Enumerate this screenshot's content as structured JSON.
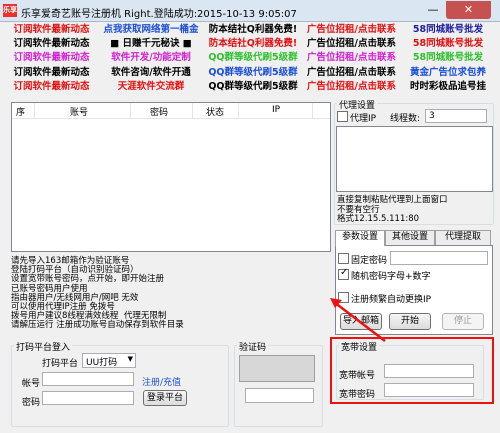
{
  "window": {
    "title": "乐享爱奇艺账号注册机    Right.登陆成功:2015-10-13 9:05:07",
    "icon_text": "乐享"
  },
  "ads": [
    [
      {
        "text": "订阅软件最新动态",
        "color": "#e11010"
      },
      {
        "text": "点我获取网络第一桶金",
        "color": "#1a4fd6"
      },
      {
        "text": "防本结社Q利器免费!",
        "color": "#000000"
      },
      {
        "text": "广告位招租/点击联系",
        "color": "#e11010"
      },
      {
        "text": "58同城账号批发",
        "color": "#2020a0"
      }
    ],
    [
      {
        "text": "订阅软件最新动态",
        "color": "#000000"
      },
      {
        "text": "■ 日赚千元秘诀 ■",
        "color": "#000000"
      },
      {
        "text": "防本结社Q利器免费!",
        "color": "#e11010"
      },
      {
        "text": "广告位招租/点击联系",
        "color": "#000000"
      },
      {
        "text": "58同城账号批发",
        "color": "#e11010"
      }
    ],
    [
      {
        "text": "订阅软件最新动态",
        "color": "#d020d0"
      },
      {
        "text": "软件开发/功能定制",
        "color": "#d020d0"
      },
      {
        "text": "QQ群等级代刷5级群",
        "color": "#30c030"
      },
      {
        "text": "广告位招租/点击联系",
        "color": "#d020d0"
      },
      {
        "text": "58同城账号批发",
        "color": "#30c030"
      }
    ],
    [
      {
        "text": "订阅软件最新动态",
        "color": "#000000"
      },
      {
        "text": "软件咨询/软件开通",
        "color": "#000000"
      },
      {
        "text": "QQ群等级代刷5级群",
        "color": "#1a4fd6"
      },
      {
        "text": "广告位招租/点击联系",
        "color": "#000000"
      },
      {
        "text": "黄金广告位求包养",
        "color": "#1a4fd6"
      }
    ],
    [
      {
        "text": "订阅软件最新动态",
        "color": "#e11010"
      },
      {
        "text": "天涯软件交流群",
        "color": "#e11010"
      },
      {
        "text": "QQ群等级代刷5级群",
        "color": "#000000"
      },
      {
        "text": "广告位招租/点击联系",
        "color": "#e11010"
      },
      {
        "text": "时时彩极品追号挂",
        "color": "#000000"
      }
    ]
  ],
  "grid": {
    "columns": [
      "序",
      "账号",
      "密码",
      "状态",
      "IP"
    ]
  },
  "proxy": {
    "group_title": "代理设置",
    "proxy_ip_label": "代理IP",
    "proxy_ip_checked": false,
    "threads_label": "线程数:",
    "threads_value": "3",
    "hint": "直接复制粘贴代理到上面窗口\n不要有空行\n格式12.15.5.111:80"
  },
  "tabs": {
    "items": [
      "参数设置",
      "其他设置",
      "代理提取"
    ],
    "active_index": 0
  },
  "params": {
    "fixed_password_label": "固定密码",
    "fixed_password_checked": false,
    "fixed_password_value": "",
    "random_password_label": "随机密码字母+数字",
    "random_password_checked": true,
    "auto_change_ip_label": "注册频繁自动更换IP",
    "auto_change_ip_checked": false
  },
  "buttons": {
    "import_email": "导入邮箱",
    "start": "开始",
    "stop": "停止",
    "login_platform": "登录平台"
  },
  "log_lines": [
    "请先导入163邮箱作为验证账号",
    "登陆打码平台（自动识别验证码）",
    "设置宽带账号密码，点开始，即开始注册",
    "已账号密码用户使用",
    "指由器用户/无线网用户/网吧 无效",
    "可以使用代理IP注册 免拨号",
    "拨号用户建议8线程满效线程  代理无限制",
    "请解压运行 注册成功账号自动保存到软件目录"
  ],
  "captcha_platform": {
    "group_title": "打码平台登入",
    "platform_label": "打码平台",
    "platform_value": "UU打码",
    "account_label": "帐号",
    "account_value": "",
    "password_label": "密码",
    "password_value": "",
    "register_link": "注册/充值"
  },
  "captcha": {
    "group_title": "验证码",
    "input_value": ""
  },
  "broadband": {
    "group_title": "宽带设置",
    "account_label": "宽带帐号",
    "account_value": "",
    "password_label": "宽带密码",
    "password_value": ""
  },
  "colors": {
    "highlight": "#ee1111",
    "link": "#1a4fd6"
  }
}
